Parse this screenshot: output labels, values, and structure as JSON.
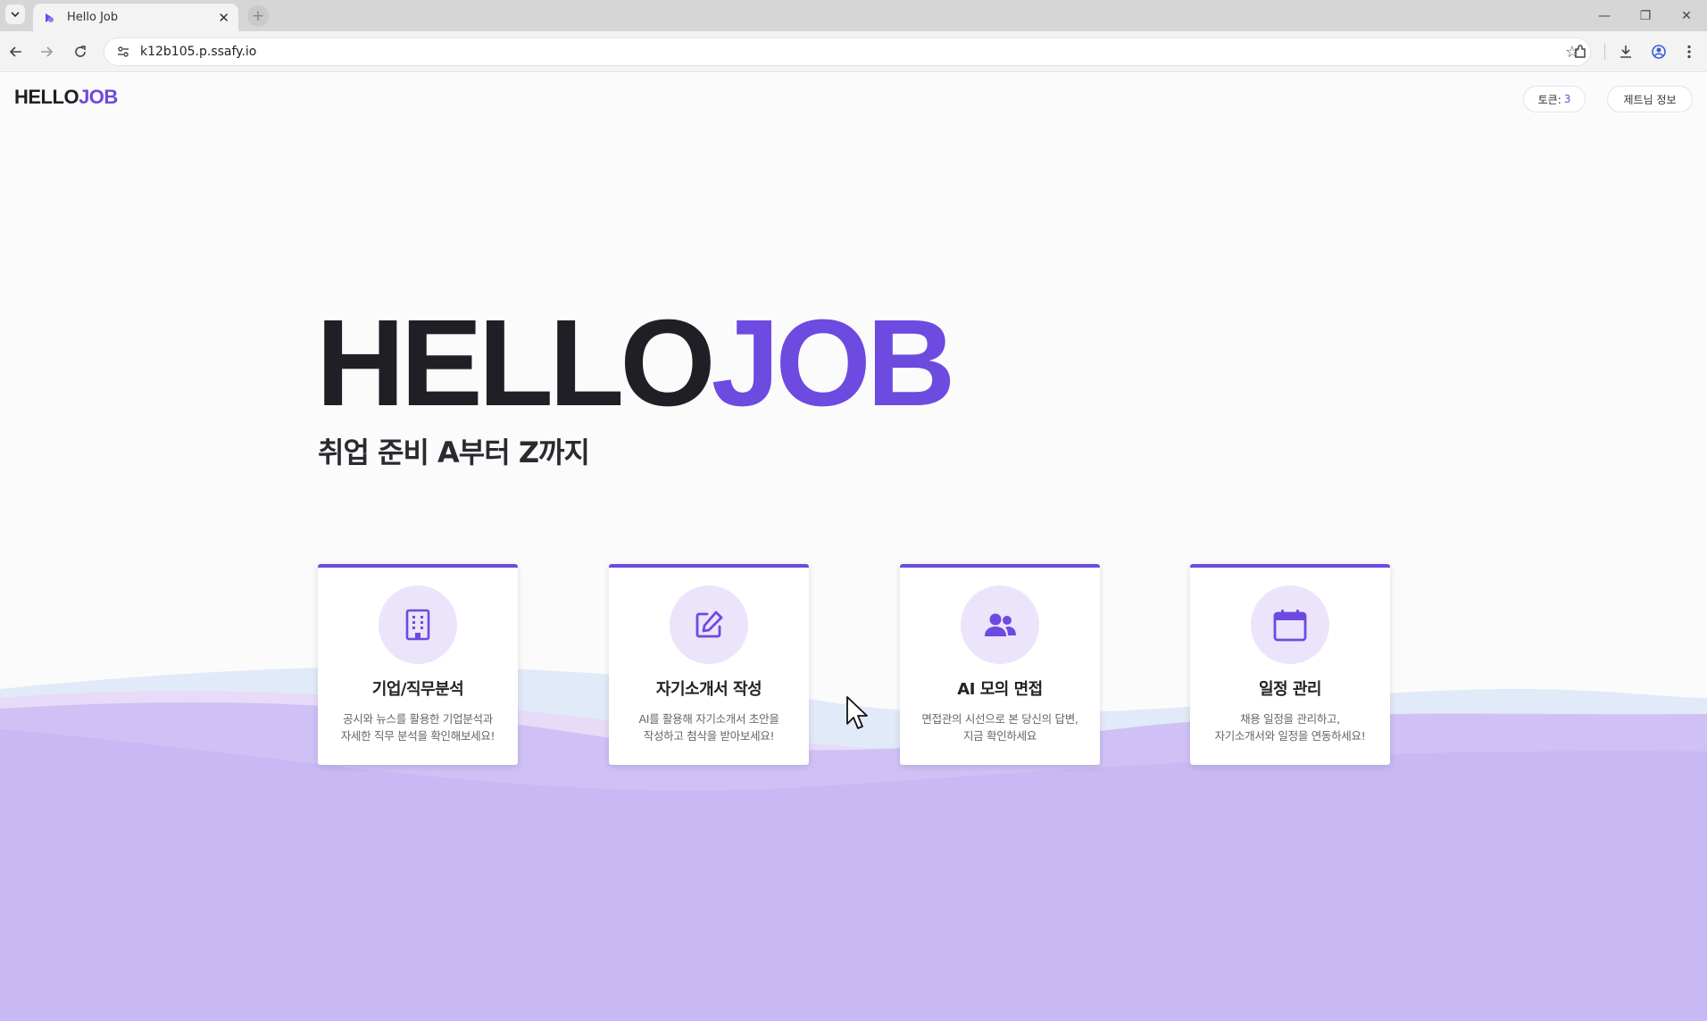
{
  "browser": {
    "tab_title": "Hello Job",
    "url": "k12b105.p.ssafy.io"
  },
  "header": {
    "logo_part1": "HELLO",
    "logo_part2": "JOB",
    "token_label": "토큰:",
    "token_count": "3",
    "user_info_label": "제트님 정보"
  },
  "hero": {
    "title_part1": "HELLO",
    "title_part2": "JOB",
    "subtitle": "취업 준비 A부터 Z까지"
  },
  "cards": [
    {
      "icon": "building-icon",
      "title": "기업/직무분석",
      "desc_line1": "공시와 뉴스를 활용한 기업분석과",
      "desc_line2": "자세한 직무 분석을 확인해보세요!"
    },
    {
      "icon": "edit-icon",
      "title": "자기소개서 작성",
      "desc_line1": "AI를 활용해 자기소개서 초안을",
      "desc_line2": "작성하고 첨삭을 받아보세요!"
    },
    {
      "icon": "users-icon",
      "title": "AI 모의 면접",
      "desc_line1": "면접관의 시선으로 본 당신의 답변,",
      "desc_line2": "지금 확인하세요"
    },
    {
      "icon": "calendar-icon",
      "title": "일정 관리",
      "desc_line1": "채용 일정을 관리하고,",
      "desc_line2": "자기소개서와 일정을 연동하세요!"
    }
  ],
  "colors": {
    "brand_purple": "#6d4ae0",
    "dark_text": "#1f1f25",
    "wave_purple": "#cbbdf5"
  }
}
